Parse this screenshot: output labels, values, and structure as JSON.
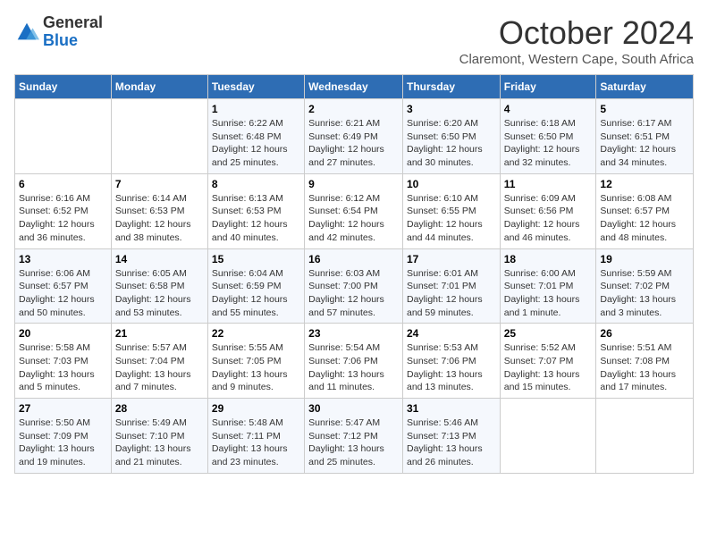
{
  "logo": {
    "line1": "General",
    "line2": "Blue"
  },
  "title": "October 2024",
  "location": "Claremont, Western Cape, South Africa",
  "headers": [
    "Sunday",
    "Monday",
    "Tuesday",
    "Wednesday",
    "Thursday",
    "Friday",
    "Saturday"
  ],
  "weeks": [
    [
      {
        "day": "",
        "info": ""
      },
      {
        "day": "",
        "info": ""
      },
      {
        "day": "1",
        "info": "Sunrise: 6:22 AM\nSunset: 6:48 PM\nDaylight: 12 hours\nand 25 minutes."
      },
      {
        "day": "2",
        "info": "Sunrise: 6:21 AM\nSunset: 6:49 PM\nDaylight: 12 hours\nand 27 minutes."
      },
      {
        "day": "3",
        "info": "Sunrise: 6:20 AM\nSunset: 6:50 PM\nDaylight: 12 hours\nand 30 minutes."
      },
      {
        "day": "4",
        "info": "Sunrise: 6:18 AM\nSunset: 6:50 PM\nDaylight: 12 hours\nand 32 minutes."
      },
      {
        "day": "5",
        "info": "Sunrise: 6:17 AM\nSunset: 6:51 PM\nDaylight: 12 hours\nand 34 minutes."
      }
    ],
    [
      {
        "day": "6",
        "info": "Sunrise: 6:16 AM\nSunset: 6:52 PM\nDaylight: 12 hours\nand 36 minutes."
      },
      {
        "day": "7",
        "info": "Sunrise: 6:14 AM\nSunset: 6:53 PM\nDaylight: 12 hours\nand 38 minutes."
      },
      {
        "day": "8",
        "info": "Sunrise: 6:13 AM\nSunset: 6:53 PM\nDaylight: 12 hours\nand 40 minutes."
      },
      {
        "day": "9",
        "info": "Sunrise: 6:12 AM\nSunset: 6:54 PM\nDaylight: 12 hours\nand 42 minutes."
      },
      {
        "day": "10",
        "info": "Sunrise: 6:10 AM\nSunset: 6:55 PM\nDaylight: 12 hours\nand 44 minutes."
      },
      {
        "day": "11",
        "info": "Sunrise: 6:09 AM\nSunset: 6:56 PM\nDaylight: 12 hours\nand 46 minutes."
      },
      {
        "day": "12",
        "info": "Sunrise: 6:08 AM\nSunset: 6:57 PM\nDaylight: 12 hours\nand 48 minutes."
      }
    ],
    [
      {
        "day": "13",
        "info": "Sunrise: 6:06 AM\nSunset: 6:57 PM\nDaylight: 12 hours\nand 50 minutes."
      },
      {
        "day": "14",
        "info": "Sunrise: 6:05 AM\nSunset: 6:58 PM\nDaylight: 12 hours\nand 53 minutes."
      },
      {
        "day": "15",
        "info": "Sunrise: 6:04 AM\nSunset: 6:59 PM\nDaylight: 12 hours\nand 55 minutes."
      },
      {
        "day": "16",
        "info": "Sunrise: 6:03 AM\nSunset: 7:00 PM\nDaylight: 12 hours\nand 57 minutes."
      },
      {
        "day": "17",
        "info": "Sunrise: 6:01 AM\nSunset: 7:01 PM\nDaylight: 12 hours\nand 59 minutes."
      },
      {
        "day": "18",
        "info": "Sunrise: 6:00 AM\nSunset: 7:01 PM\nDaylight: 13 hours\nand 1 minute."
      },
      {
        "day": "19",
        "info": "Sunrise: 5:59 AM\nSunset: 7:02 PM\nDaylight: 13 hours\nand 3 minutes."
      }
    ],
    [
      {
        "day": "20",
        "info": "Sunrise: 5:58 AM\nSunset: 7:03 PM\nDaylight: 13 hours\nand 5 minutes."
      },
      {
        "day": "21",
        "info": "Sunrise: 5:57 AM\nSunset: 7:04 PM\nDaylight: 13 hours\nand 7 minutes."
      },
      {
        "day": "22",
        "info": "Sunrise: 5:55 AM\nSunset: 7:05 PM\nDaylight: 13 hours\nand 9 minutes."
      },
      {
        "day": "23",
        "info": "Sunrise: 5:54 AM\nSunset: 7:06 PM\nDaylight: 13 hours\nand 11 minutes."
      },
      {
        "day": "24",
        "info": "Sunrise: 5:53 AM\nSunset: 7:06 PM\nDaylight: 13 hours\nand 13 minutes."
      },
      {
        "day": "25",
        "info": "Sunrise: 5:52 AM\nSunset: 7:07 PM\nDaylight: 13 hours\nand 15 minutes."
      },
      {
        "day": "26",
        "info": "Sunrise: 5:51 AM\nSunset: 7:08 PM\nDaylight: 13 hours\nand 17 minutes."
      }
    ],
    [
      {
        "day": "27",
        "info": "Sunrise: 5:50 AM\nSunset: 7:09 PM\nDaylight: 13 hours\nand 19 minutes."
      },
      {
        "day": "28",
        "info": "Sunrise: 5:49 AM\nSunset: 7:10 PM\nDaylight: 13 hours\nand 21 minutes."
      },
      {
        "day": "29",
        "info": "Sunrise: 5:48 AM\nSunset: 7:11 PM\nDaylight: 13 hours\nand 23 minutes."
      },
      {
        "day": "30",
        "info": "Sunrise: 5:47 AM\nSunset: 7:12 PM\nDaylight: 13 hours\nand 25 minutes."
      },
      {
        "day": "31",
        "info": "Sunrise: 5:46 AM\nSunset: 7:13 PM\nDaylight: 13 hours\nand 26 minutes."
      },
      {
        "day": "",
        "info": ""
      },
      {
        "day": "",
        "info": ""
      }
    ]
  ]
}
